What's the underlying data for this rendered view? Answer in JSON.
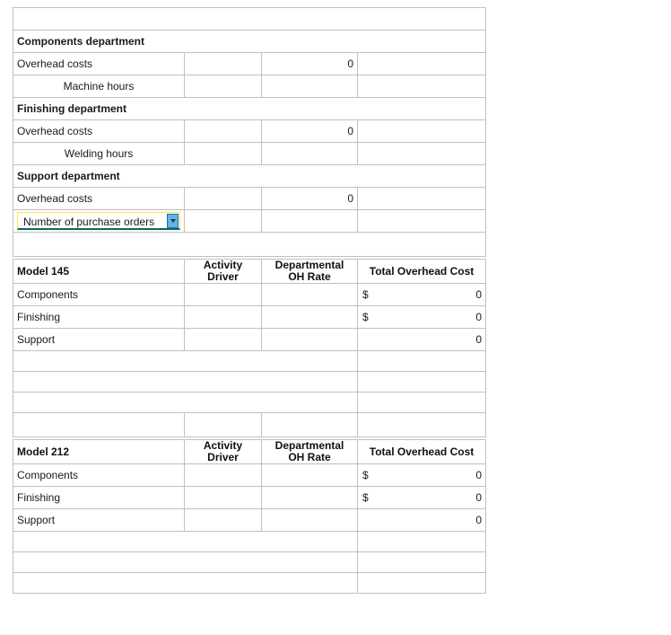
{
  "worksheet": {
    "title_band": "",
    "columns": [
      "",
      "Activity Driver",
      "Departmental OH Rate",
      "Total Overhead Cost"
    ],
    "currency_symbol": "$",
    "zero": "0",
    "colors": {
      "header_blue": "#8aa4d6",
      "input_yellow_fill": "#ffffb3",
      "input_yellow_border": "#ffe24d",
      "grid_line": "#c0c0c0",
      "dropdown_button": "#5fb4e8",
      "dropdown_underline": "#0b6b5b"
    }
  },
  "departments": [
    {
      "name": "Components department",
      "overhead_label": "Overhead costs",
      "overhead_value": "0",
      "driver_label": "Machine hours"
    },
    {
      "name": "Finishing department",
      "overhead_label": "Overhead costs",
      "overhead_value": "0",
      "driver_label": "Welding hours"
    },
    {
      "name": "Support department",
      "overhead_label": "Overhead costs",
      "overhead_value": "0",
      "driver_select": {
        "value": "Number of purchase orders",
        "options": [
          "Number of purchase orders"
        ],
        "arrow_icon": "chevron-down-icon"
      }
    }
  ],
  "models": [
    {
      "name": "Model 145",
      "headers": {
        "activity_driver": "Activity Driver",
        "oh_rate": "Departmental OH Rate",
        "total": "Total Overhead Cost"
      },
      "rows": [
        {
          "label": "Components",
          "activity_driver": "",
          "oh_rate": "",
          "currency": "$",
          "total": "0"
        },
        {
          "label": "Finishing",
          "activity_driver": "",
          "oh_rate": "",
          "currency": "$",
          "total": "0"
        },
        {
          "label": "Support",
          "activity_driver": "",
          "oh_rate": "",
          "currency": "",
          "total": "0"
        }
      ],
      "total_rows": [
        {
          "label": "",
          "value": ""
        },
        {
          "label": "",
          "value": ""
        },
        {
          "label": "",
          "value": ""
        }
      ]
    },
    {
      "name": "Model 212",
      "headers": {
        "activity_driver": "Activity Driver",
        "oh_rate": "Departmental OH Rate",
        "total": "Total Overhead Cost"
      },
      "rows": [
        {
          "label": "Components",
          "activity_driver": "",
          "oh_rate": "",
          "currency": "$",
          "total": "0"
        },
        {
          "label": "Finishing",
          "activity_driver": "",
          "oh_rate": "",
          "currency": "$",
          "total": "0"
        },
        {
          "label": "Support",
          "activity_driver": "",
          "oh_rate": "",
          "currency": "",
          "total": "0"
        }
      ],
      "total_rows": [
        {
          "label": "",
          "value": ""
        },
        {
          "label": "",
          "value": ""
        },
        {
          "label": "",
          "value": ""
        }
      ]
    }
  ]
}
